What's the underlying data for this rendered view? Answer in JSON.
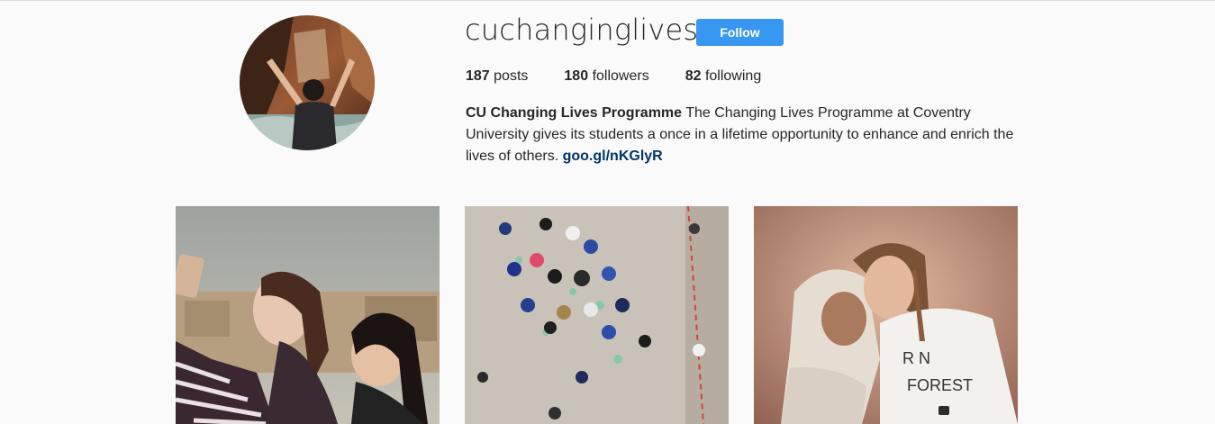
{
  "profile": {
    "username": "cuchanginglives",
    "follow_label": "Follow",
    "stats": {
      "posts_count": "187",
      "posts_label": "posts",
      "followers_count": "180",
      "followers_label": "followers",
      "following_count": "82",
      "following_label": "following"
    },
    "bio": {
      "full_name": "CU Changing Lives Programme",
      "text": "The Changing Lives Programme at Coventry University gives its students a once in a lifetime opportunity to enhance and enrich the lives of others.",
      "link": "goo.gl/nKGlyR"
    }
  },
  "colors": {
    "follow_button": "#3897f0",
    "link": "#003569",
    "text": "#262626",
    "background": "#fafafa"
  }
}
